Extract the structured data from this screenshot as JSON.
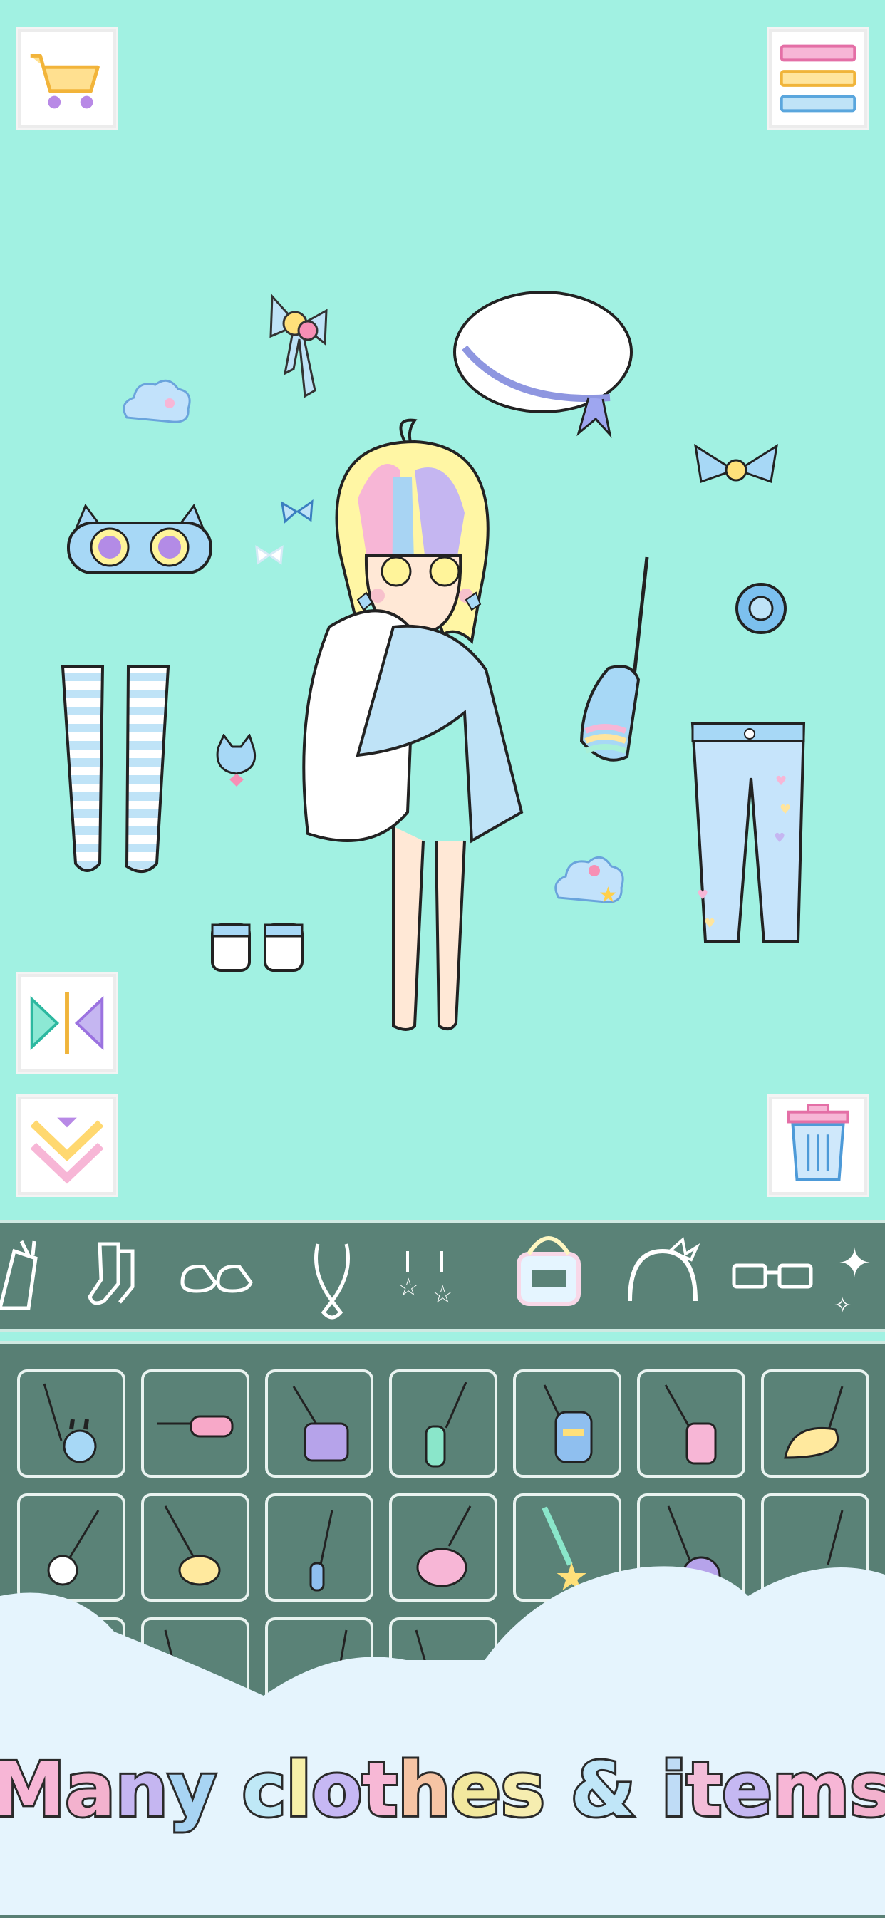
{
  "buttons": {
    "cart": "cart-icon",
    "menu": "hamburger-menu-icon",
    "flip": "flip-icon",
    "collapse": "chevron-double-down-icon",
    "trash": "trash-icon"
  },
  "categories": [
    {
      "name": "dress"
    },
    {
      "name": "socks"
    },
    {
      "name": "shoes"
    },
    {
      "name": "necklace"
    },
    {
      "name": "earrings"
    },
    {
      "name": "bag",
      "selected": true
    },
    {
      "name": "headband"
    },
    {
      "name": "glasses"
    },
    {
      "name": "effects"
    }
  ],
  "items_grid": [
    [
      "bunny-bag",
      "pink-pouch",
      "purple-bag",
      "green-bottle",
      "blue-waist-bag",
      "pink-bag",
      "yellow-bag"
    ],
    [
      "bear-charm",
      "candy-bag",
      "stick-item",
      "pink-guitar-bag",
      "star-wand",
      "cat-bag",
      "stick-item-2"
    ],
    [
      "stick-item-3",
      "stick-item-4",
      "stick-item-5",
      "stick-item-6"
    ]
  ],
  "caption": {
    "text": "Many clothes & items",
    "colors": [
      "#f7b6d6",
      "#f3b2ce",
      "#c5b6f1",
      "#a8d4f3",
      "#bfe8f6",
      "#f6efa8",
      "#c6b8f4",
      "#f7b8d6",
      "#f6c4a4",
      "#f2e89e",
      "#f6edb0",
      "#c0e6f8",
      "#bfdcf6",
      "#f3bdd9",
      "#c5b8f2"
    ]
  }
}
